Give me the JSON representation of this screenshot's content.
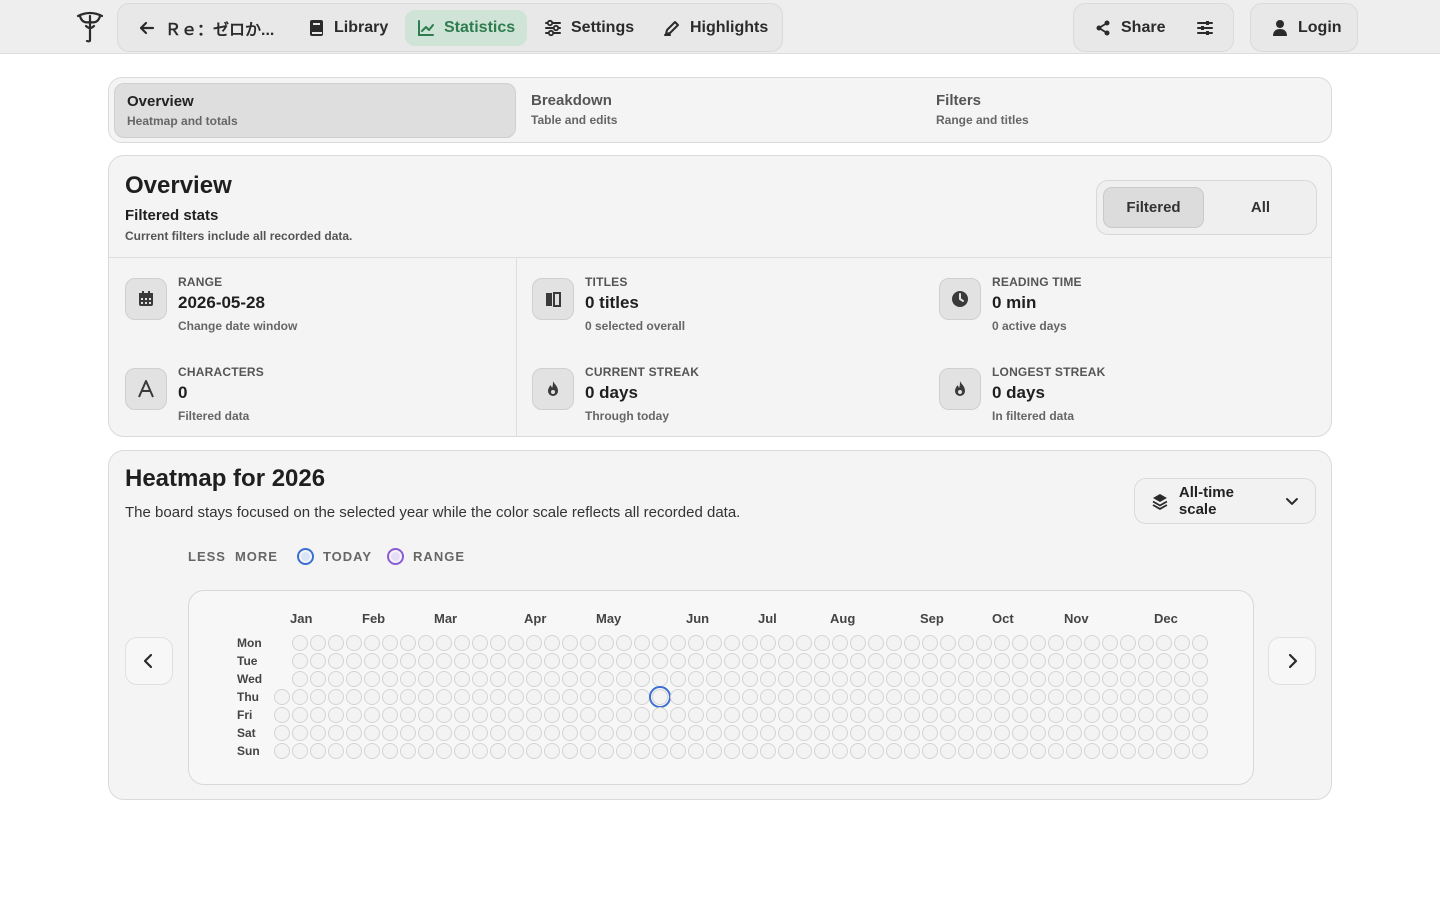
{
  "nav": {
    "back_title": "Ｒｅ：ゼロか...",
    "library": "Library",
    "statistics": "Statistics",
    "settings": "Settings",
    "highlights": "Highlights",
    "share": "Share",
    "login": "Login",
    "accent": "#2e7d4f"
  },
  "tabs": [
    {
      "title": "Overview",
      "subtitle": "Heatmap and totals",
      "active": true
    },
    {
      "title": "Breakdown",
      "subtitle": "Table and edits",
      "active": false
    },
    {
      "title": "Filters",
      "subtitle": "Range and titles",
      "active": false
    }
  ],
  "overview": {
    "title": "Overview",
    "subtitle": "Filtered stats",
    "note": "Current filters include all recorded data.",
    "toggle": {
      "selected": "Filtered",
      "other": "All"
    },
    "stats": [
      {
        "icon": "calendar-icon",
        "label": "RANGE",
        "value": "2026-05-28",
        "sub": "Change date window"
      },
      {
        "icon": "book-icon",
        "label": "TITLES",
        "value": "0 titles",
        "sub": "0 selected overall"
      },
      {
        "icon": "clock-icon",
        "label": "READING TIME",
        "value": "0 min",
        "sub": "0 active days"
      },
      {
        "icon": "letter-a-icon",
        "label": "CHARACTERS",
        "value": "0",
        "sub": "Filtered data"
      },
      {
        "icon": "flame-icon",
        "label": "CURRENT STREAK",
        "value": "0 days",
        "sub": "Through today"
      },
      {
        "icon": "flame-icon",
        "label": "LONGEST STREAK",
        "value": "0 days",
        "sub": "In filtered data"
      }
    ]
  },
  "heatmap": {
    "title": "Heatmap for 2026",
    "description": "The board stays focused on the selected year while the color scale reflects all recorded data.",
    "scale_button": "All-time scale",
    "legend": {
      "less": "LESS",
      "more": "MORE",
      "today": "TODAY",
      "range": "RANGE"
    },
    "months": [
      "Jan",
      "Feb",
      "Mar",
      "Apr",
      "May",
      "Jun",
      "Jul",
      "Aug",
      "Sep",
      "Oct",
      "Nov",
      "Dec"
    ],
    "days": [
      "Mon",
      "Tue",
      "Wed",
      "Thu",
      "Fri",
      "Sat",
      "Sun"
    ],
    "year": 2026,
    "today": "2026-05-28",
    "today_color": "#3b6fd6",
    "range_color": "#8b5cd6",
    "empty_color": "#d4d4d4"
  }
}
